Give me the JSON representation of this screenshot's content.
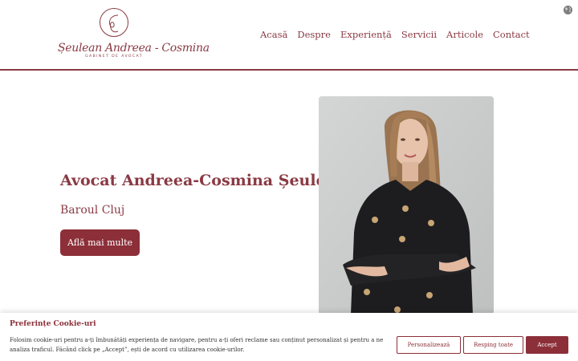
{
  "header": {
    "logo": {
      "monogram": "C",
      "name": "Șeulean Andreea - Cosmina",
      "tagline": "GABINET DE AVOCAT"
    },
    "nav": [
      {
        "label": "Acasă"
      },
      {
        "label": "Despre"
      },
      {
        "label": "Experiență"
      },
      {
        "label": "Servicii"
      },
      {
        "label": "Articole"
      },
      {
        "label": "Contact"
      }
    ],
    "language_icon": "globe-icon"
  },
  "hero": {
    "title": "Avocat Andreea-Cosmina Șeulean",
    "subtitle": "Baroul Cluj",
    "cta_label": "Află mai multe"
  },
  "cookie": {
    "title": "Preferințe Cookie-uri",
    "text": "Folosim cookie-uri pentru a-ți îmbunătăți experiența de navigare, pentru a-ți oferi reclame sau conținut personalizat și pentru a ne analiza traficul. Făcând click pe „Accept”, ești de acord cu utilizarea cookie-urilor.",
    "buttons": {
      "customize": "Personalizează",
      "reject": "Resping toate",
      "accept": "Accept"
    }
  },
  "colors": {
    "brand": "#8c2f39",
    "photo_background": "#cfd0d0"
  }
}
